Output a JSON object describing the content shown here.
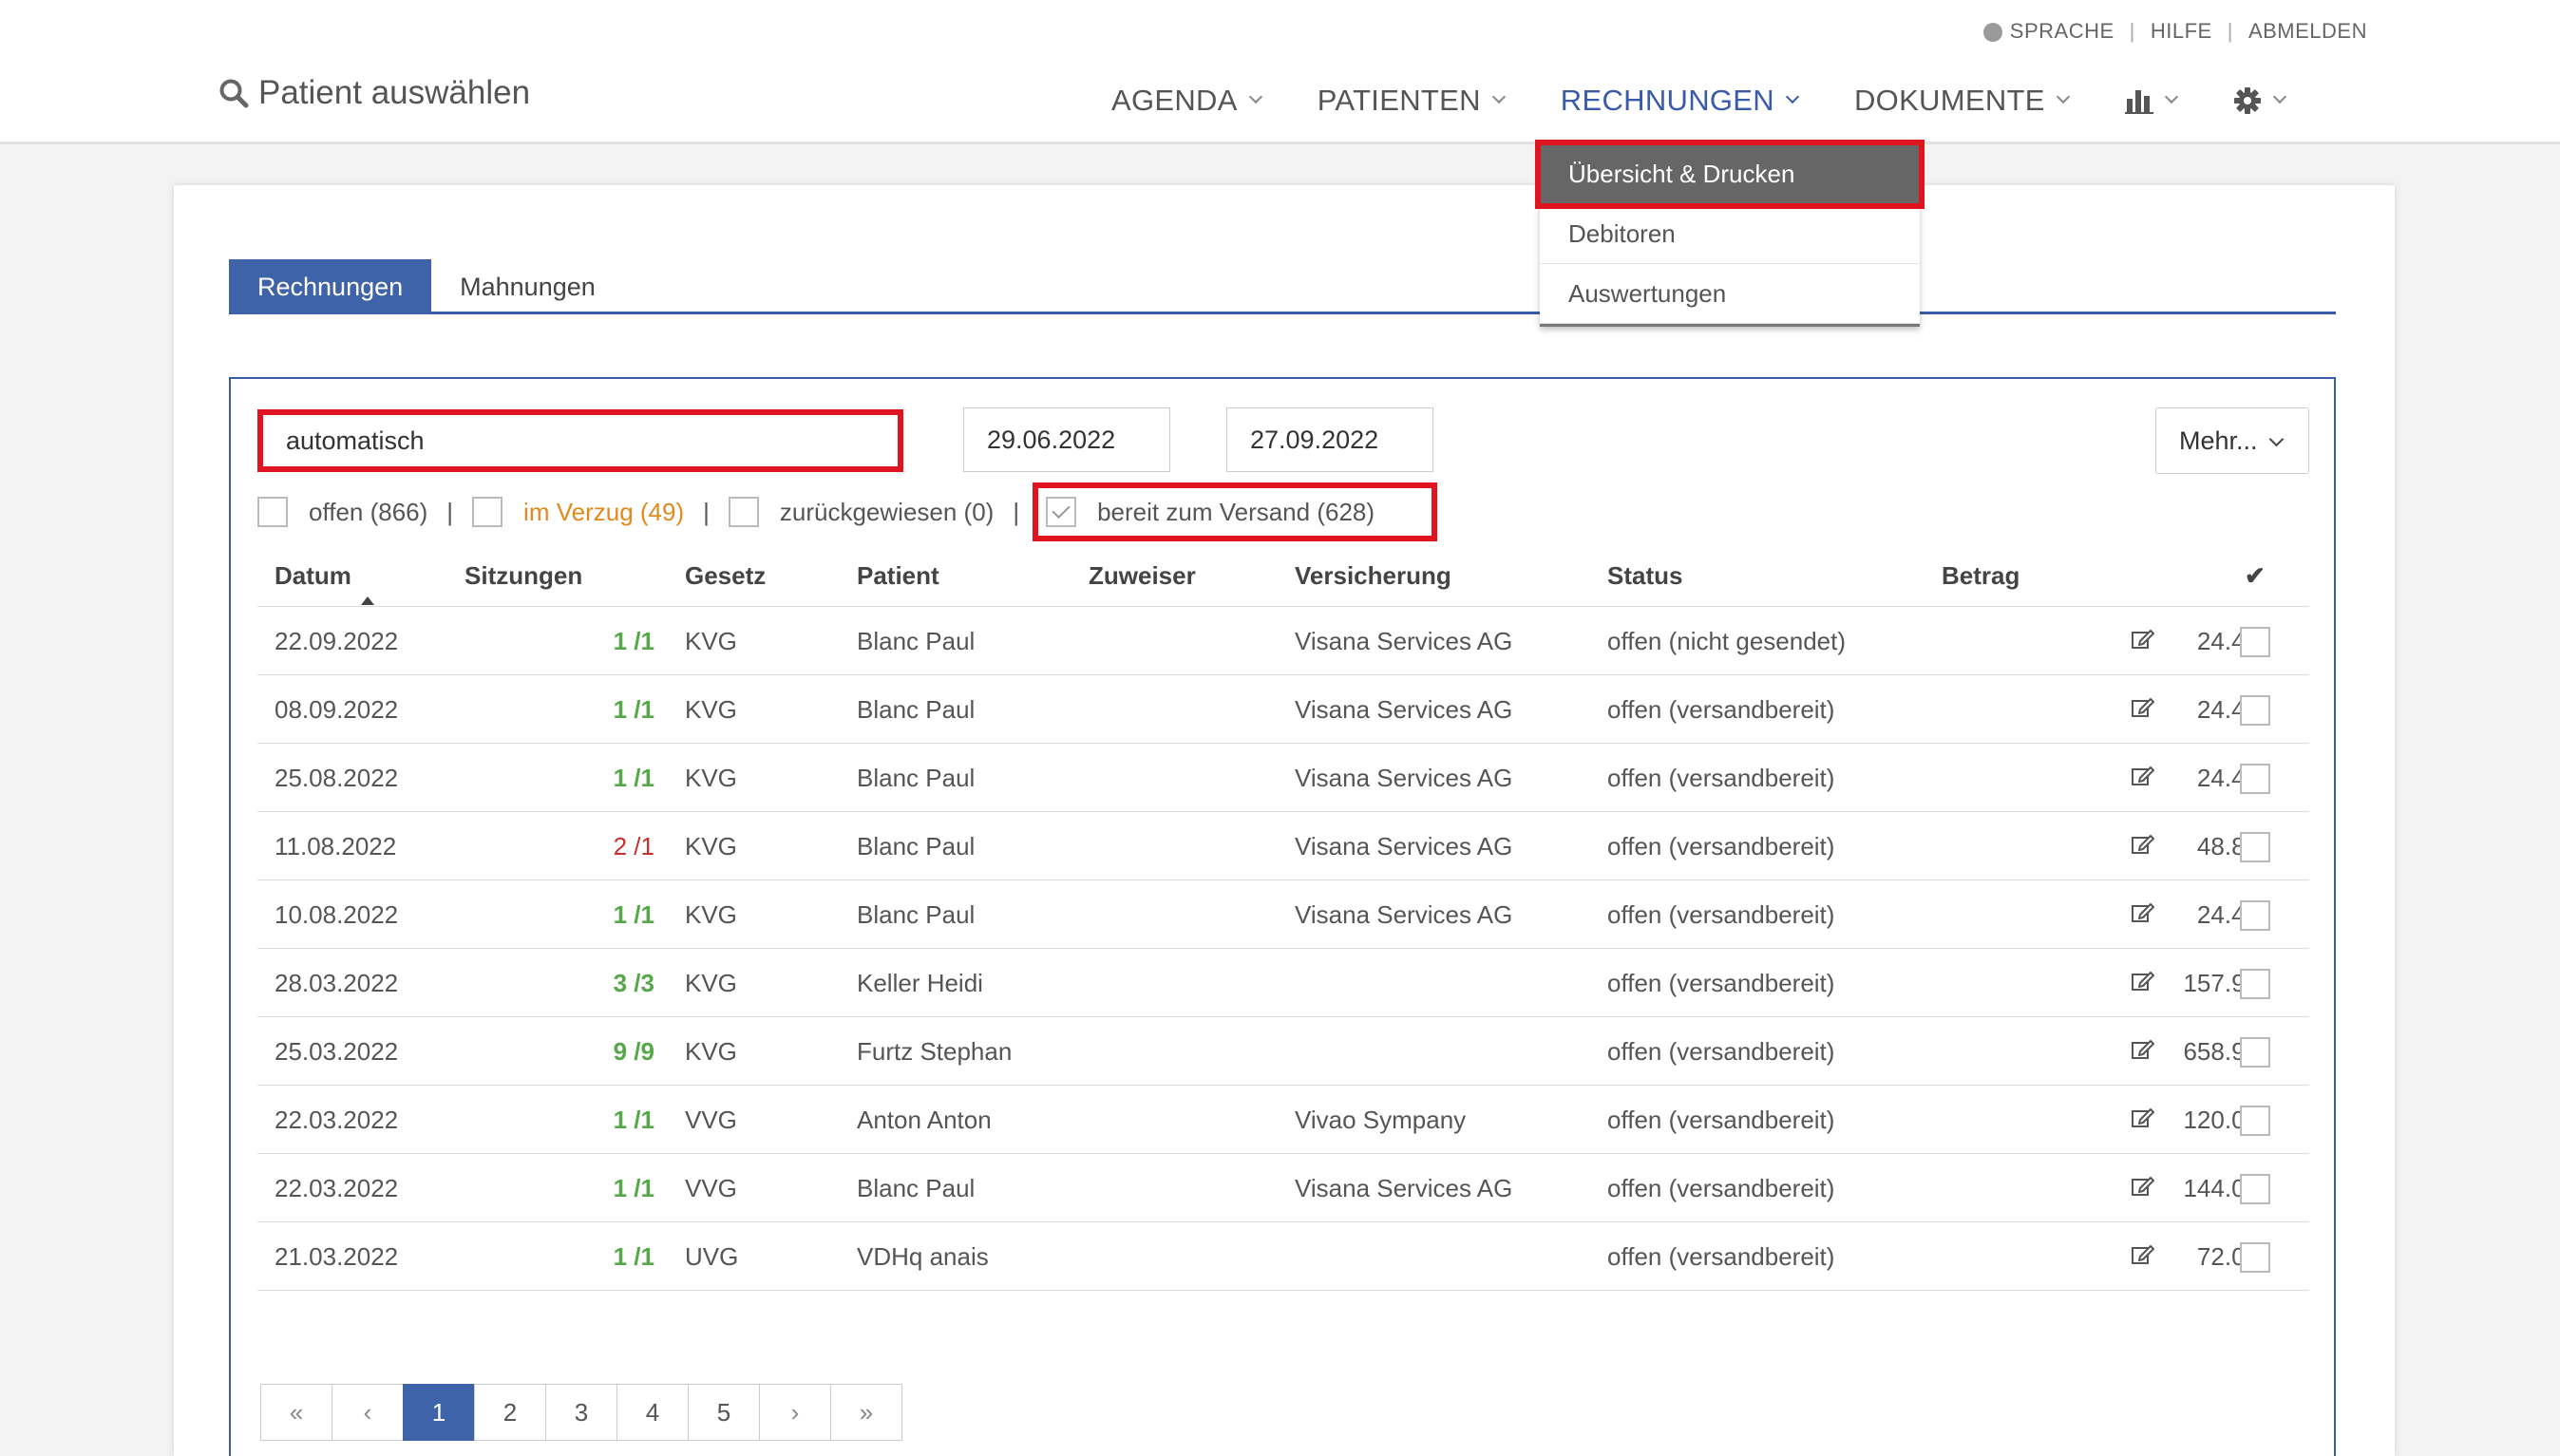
{
  "header": {
    "top_links": [
      "SPRACHE",
      "HILFE",
      "ABMELDEN"
    ],
    "patient_search_label": "Patient auswählen",
    "nav": [
      {
        "label": "AGENDA"
      },
      {
        "label": "PATIENTEN"
      },
      {
        "label": "RECHNUNGEN"
      },
      {
        "label": "DOKUMENTE"
      }
    ]
  },
  "dropdown": {
    "items": [
      "Übersicht & Drucken",
      "Debitoren",
      "Auswertungen"
    ]
  },
  "tabs": [
    "Rechnungen",
    "Mahnungen"
  ],
  "filters": {
    "search_value": "automatisch",
    "date_from": "29.06.2022",
    "date_to": "27.09.2022",
    "more_label": "Mehr...",
    "status_checks": [
      {
        "label": "offen (866)"
      },
      {
        "label": "im Verzug (49)"
      },
      {
        "label": "zurückgewiesen (0)"
      },
      {
        "label": "bereit zum Versand (628)"
      }
    ]
  },
  "table": {
    "headers": [
      "Datum",
      "Sitzungen",
      "Gesetz",
      "Patient",
      "Zuweiser",
      "Versicherung",
      "Status",
      "Betrag",
      "✔"
    ],
    "rows": [
      {
        "datum": "22.09.2022",
        "sitzungen": "1 /1",
        "gesetz": "KVG",
        "patient": "Blanc Paul",
        "zuweiser": "",
        "versicherung": "Visana Services AG",
        "status": "offen (nicht gesendet)",
        "betrag": "24.40"
      },
      {
        "datum": "08.09.2022",
        "sitzungen": "1 /1",
        "gesetz": "KVG",
        "patient": "Blanc Paul",
        "zuweiser": "",
        "versicherung": "Visana Services AG",
        "status": "offen (versandbereit)",
        "betrag": "24.40"
      },
      {
        "datum": "25.08.2022",
        "sitzungen": "1 /1",
        "gesetz": "KVG",
        "patient": "Blanc Paul",
        "zuweiser": "",
        "versicherung": "Visana Services AG",
        "status": "offen (versandbereit)",
        "betrag": "24.40"
      },
      {
        "datum": "11.08.2022",
        "sitzungen": "2 /1",
        "gesetz": "KVG",
        "patient": "Blanc Paul",
        "zuweiser": "",
        "versicherung": "Visana Services AG",
        "status": "offen (versandbereit)",
        "betrag": "48.85"
      },
      {
        "datum": "10.08.2022",
        "sitzungen": "1 /1",
        "gesetz": "KVG",
        "patient": "Blanc Paul",
        "zuweiser": "",
        "versicherung": "Visana Services AG",
        "status": "offen (versandbereit)",
        "betrag": "24.40"
      },
      {
        "datum": "28.03.2022",
        "sitzungen": "3 /3",
        "gesetz": "KVG",
        "patient": "Keller Heidi",
        "zuweiser": "",
        "versicherung": "",
        "status": "offen (versandbereit)",
        "betrag": "157.90"
      },
      {
        "datum": "25.03.2022",
        "sitzungen": "9 /9",
        "gesetz": "KVG",
        "patient": "Furtz Stephan",
        "zuweiser": "",
        "versicherung": "",
        "status": "offen (versandbereit)",
        "betrag": "658.95"
      },
      {
        "datum": "22.03.2022",
        "sitzungen": "1 /1",
        "gesetz": "VVG",
        "patient": "Anton Anton",
        "zuweiser": "",
        "versicherung": "Vivao Sympany",
        "status": "offen (versandbereit)",
        "betrag": "120.00"
      },
      {
        "datum": "22.03.2022",
        "sitzungen": "1 /1",
        "gesetz": "VVG",
        "patient": "Blanc Paul",
        "zuweiser": "",
        "versicherung": "Visana Services AG",
        "status": "offen (versandbereit)",
        "betrag": "144.00"
      },
      {
        "datum": "21.03.2022",
        "sitzungen": "1 /1",
        "gesetz": "UVG",
        "patient": "VDHq anais",
        "zuweiser": "",
        "versicherung": "",
        "status": "offen (versandbereit)",
        "betrag": "72.00"
      }
    ]
  },
  "pagination": {
    "first": "«",
    "prev": "‹",
    "pages": [
      "1",
      "2",
      "3",
      "4",
      "5"
    ],
    "next": "›",
    "last": "»"
  },
  "colors": {
    "accent": "#3f63a8",
    "highlight_red": "#e0141e",
    "green": "#56a84a",
    "red": "#c9302c",
    "orange": "#e08a1e"
  }
}
